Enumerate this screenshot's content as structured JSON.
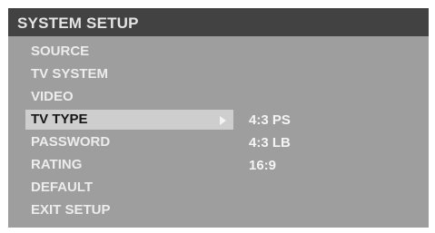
{
  "menu": {
    "title": "SYSTEM SETUP",
    "items": [
      {
        "label": "SOURCE"
      },
      {
        "label": "TV SYSTEM"
      },
      {
        "label": "VIDEO"
      },
      {
        "label": "TV TYPE"
      },
      {
        "label": "PASSWORD"
      },
      {
        "label": "RATING"
      },
      {
        "label": "DEFAULT"
      },
      {
        "label": "EXIT   SETUP"
      }
    ],
    "selected_index": 3
  },
  "submenu": {
    "pointer_icon": "right-arrow-icon",
    "options": [
      {
        "label": "4:3 PS"
      },
      {
        "label": "4:3 LB"
      },
      {
        "label": "16:9"
      }
    ]
  },
  "colors": {
    "header_bg": "#424242",
    "panel_bg": "#9e9e9e",
    "highlight_bg": "#cecece",
    "text_light": "#ececec",
    "text_selected": "#161616"
  }
}
